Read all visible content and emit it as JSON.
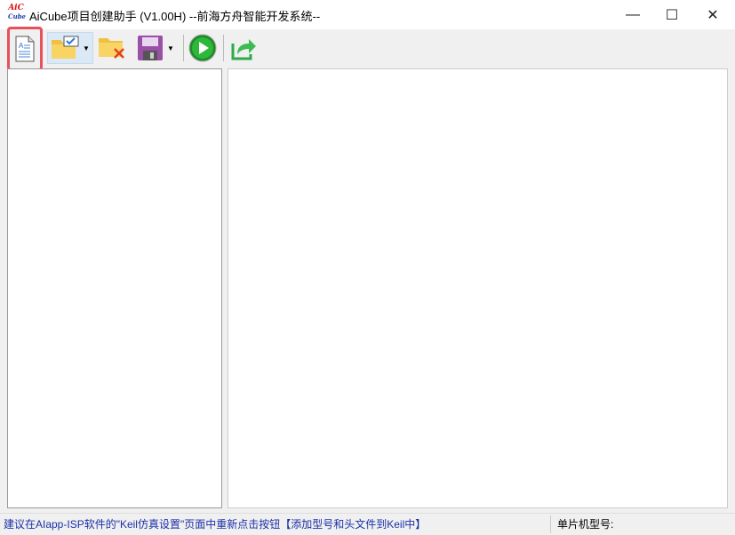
{
  "window": {
    "title": "AiCube项目创建助手 (V1.00H) --前海方舟智能开发系统--",
    "logo_text": "AiC Cube",
    "minimize": "—",
    "maximize": "☐",
    "close": "✕"
  },
  "toolbar": {
    "items": [
      "new-document",
      "open-project",
      "close-project",
      "save",
      "run",
      "export"
    ]
  },
  "status": {
    "message": "建议在AIapp-ISP软件的\"Keil仿真设置\"页面中重新点击按钮【添加型号和头文件到Keil中】",
    "mcu_label": "单片机型号:"
  },
  "colors": {
    "highlight": "#e8505b",
    "status_text": "#1b2fa8"
  }
}
